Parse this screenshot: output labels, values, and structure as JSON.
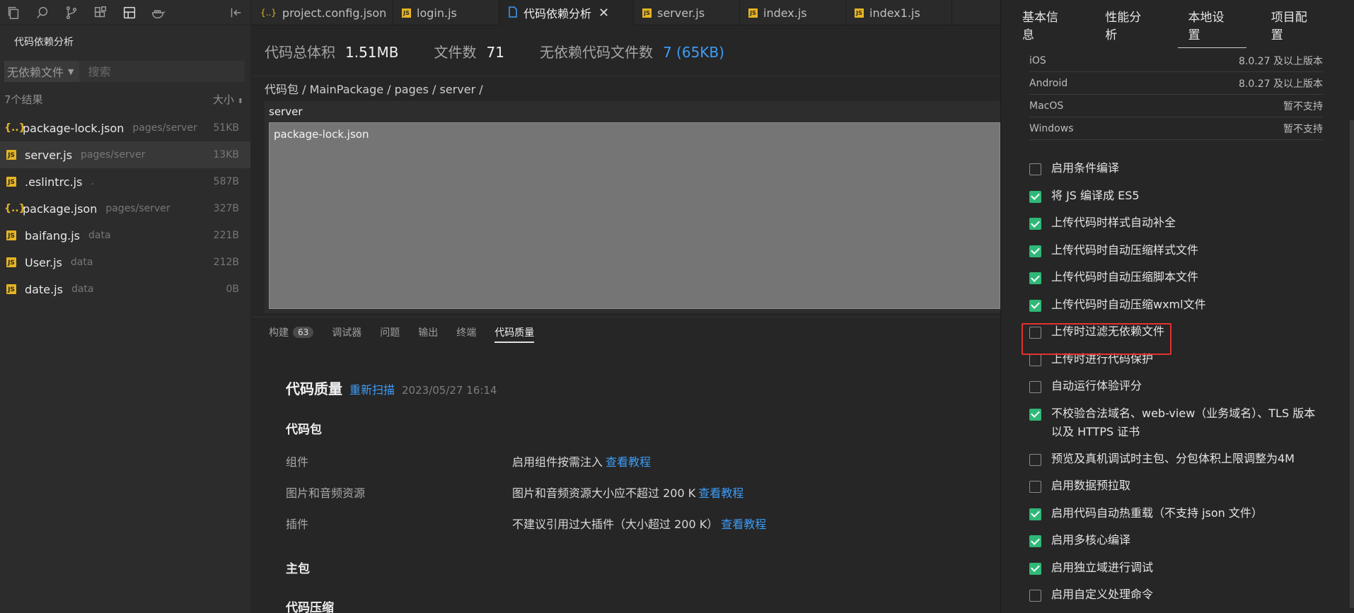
{
  "sidebar": {
    "title": "代码依赖分析",
    "filter": {
      "selected": "无依赖文件",
      "search_placeholder": "搜索"
    },
    "results_count": "7个结果",
    "sort_label": "大小",
    "files": [
      {
        "icon": "json",
        "icon_text": "{..}",
        "name": "package-lock.json",
        "path": "pages/server",
        "size": "51KB",
        "active": false
      },
      {
        "icon": "js",
        "icon_text": "JS",
        "name": "server.js",
        "path": "pages/server",
        "size": "13KB",
        "active": true
      },
      {
        "icon": "js",
        "icon_text": "JS",
        "name": ".eslintrc.js",
        "path": ".",
        "size": "587B",
        "active": false
      },
      {
        "icon": "json",
        "icon_text": "{..}",
        "name": "package.json",
        "path": "pages/server",
        "size": "327B",
        "active": false
      },
      {
        "icon": "js",
        "icon_text": "JS",
        "name": "baifang.js",
        "path": "data",
        "size": "221B",
        "active": false
      },
      {
        "icon": "js",
        "icon_text": "JS",
        "name": "User.js",
        "path": "data",
        "size": "212B",
        "active": false
      },
      {
        "icon": "js",
        "icon_text": "JS",
        "name": "date.js",
        "path": "data",
        "size": "0B",
        "active": false
      }
    ]
  },
  "tabs": [
    {
      "icon": "json",
      "icon_text": "{..}",
      "label": "project.config.json",
      "active": false
    },
    {
      "icon": "js",
      "icon_text": "JS",
      "label": "login.js",
      "active": false
    },
    {
      "icon": "doc",
      "icon_text": "",
      "label": "代码依赖分析",
      "active": true,
      "close": "✕"
    },
    {
      "icon": "js",
      "icon_text": "JS",
      "label": "server.js",
      "active": false
    },
    {
      "icon": "js",
      "icon_text": "JS",
      "label": "index.js",
      "active": false
    },
    {
      "icon": "js",
      "icon_text": "JS",
      "label": "index1.js",
      "active": false
    }
  ],
  "stats": {
    "total_label": "代码总体积",
    "total_value": "1.51MB",
    "files_label": "文件数",
    "files_value": "71",
    "nodep_label": "无依赖代码文件数",
    "nodep_value": "7 (65KB)"
  },
  "breadcrumb": "代码包 / MainPackage / pages / server /",
  "tree": {
    "root": "server",
    "block": "package-lock.json"
  },
  "panel_tabs": [
    {
      "label": "构建",
      "badge": "63",
      "active": false
    },
    {
      "label": "调试器",
      "active": false
    },
    {
      "label": "问题",
      "active": false
    },
    {
      "label": "输出",
      "active": false
    },
    {
      "label": "终端",
      "active": false
    },
    {
      "label": "代码质量",
      "active": true
    }
  ],
  "quality": {
    "title": "代码质量",
    "rescan": "重新扫描",
    "time": "2023/05/27 16:14",
    "section_package": "代码包",
    "rows": [
      {
        "label": "组件",
        "value": "启用组件按需注入",
        "action": "查看教程"
      },
      {
        "label": "图片和音频资源",
        "value": "图片和音频资源大小应不超过 200 K",
        "action": "查看教程"
      },
      {
        "label": "插件",
        "value": "不建议引用过大插件（大小超过 200 K）",
        "action": "查看教程"
      }
    ],
    "section_main": "主包",
    "section_compress": "代码压缩"
  },
  "right_tabs": [
    {
      "label": "基本信息",
      "active": false
    },
    {
      "label": "性能分析",
      "active": false
    },
    {
      "label": "本地设置",
      "active": true
    },
    {
      "label": "项目配置",
      "active": false
    }
  ],
  "os_support": [
    {
      "os": "iOS",
      "value": "8.0.27 及以上版本"
    },
    {
      "os": "Android",
      "value": "8.0.27 及以上版本"
    },
    {
      "os": "MacOS",
      "value": "暂不支持"
    },
    {
      "os": "Windows",
      "value": "暂不支持"
    }
  ],
  "settings": [
    {
      "label": "启用条件编译",
      "checked": false
    },
    {
      "label": "将 JS 编译成 ES5",
      "checked": true
    },
    {
      "label": "上传代码时样式自动补全",
      "checked": true
    },
    {
      "label": "上传代码时自动压缩样式文件",
      "checked": true
    },
    {
      "label": "上传代码时自动压缩脚本文件",
      "checked": true
    },
    {
      "label": "上传代码时自动压缩wxml文件",
      "checked": true
    },
    {
      "label": "上传时过滤无依赖文件",
      "checked": false
    },
    {
      "label": "上传时进行代码保护",
      "checked": false
    },
    {
      "label": "自动运行体验评分",
      "checked": false
    },
    {
      "label": "不校验合法域名、web-view（业务域名）、TLS 版本以及 HTTPS 证书",
      "checked": true,
      "tall": true
    },
    {
      "label": "预览及真机调试时主包、分包体积上限调整为4M",
      "checked": false
    },
    {
      "label": "启用数据预拉取",
      "checked": false
    },
    {
      "label": "启用代码自动热重载（不支持 json 文件）",
      "checked": true
    },
    {
      "label": "启用多核心编译",
      "checked": true
    },
    {
      "label": "启用独立域进行调试",
      "checked": true
    },
    {
      "label": "启用自定义处理命令",
      "checked": false
    }
  ],
  "colors": {
    "accent": "#3e9cf7",
    "check": "#2fb877",
    "highlight": "#e3322d"
  }
}
